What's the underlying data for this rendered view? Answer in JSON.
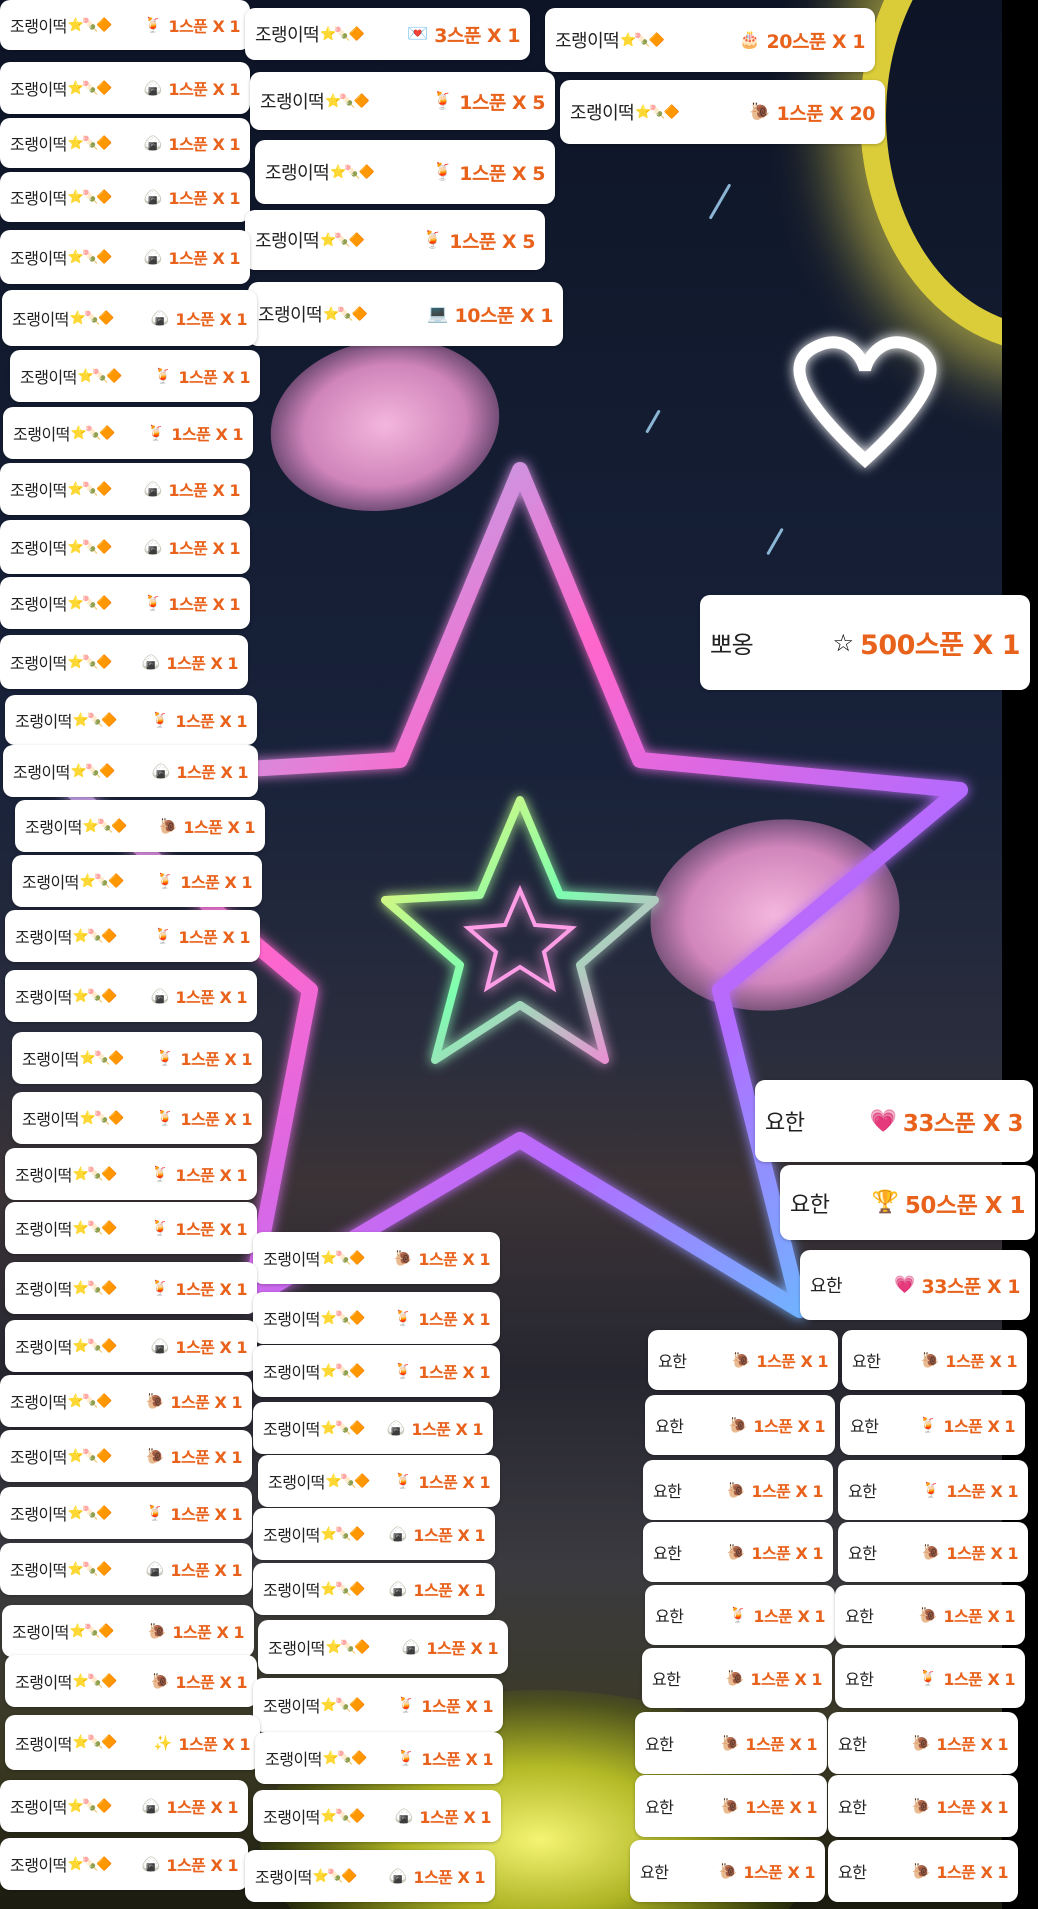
{
  "users": {
    "a": "조랭이떡",
    "b": "뽀옹",
    "c": "요한"
  },
  "badge_emoji": "⭐🍡🔶",
  "icons": {
    "juice": "🍹",
    "onigiri": "🍙",
    "snail": "🐌",
    "letter": "💌",
    "cake": "🎂",
    "laptop": "💻",
    "star": "☆",
    "gift_pink": "💗",
    "trophy": "🏆",
    "sparkle": "✨"
  },
  "amounts": {
    "s1x1": "1스푼 X 1",
    "s1x5": "1스푼 X 5",
    "s1x20": "1스푼 X 20",
    "s3x1": "3스푼 X 1",
    "s10x1": "10스푼 X 1",
    "s20x1": "20스푼 X 1",
    "s33x1": "33스푼 X 1",
    "s33x3": "33스푼 X 3",
    "s50x1": "50스푼 X 1",
    "s500x1": "500스푼 X 1"
  },
  "colors": {
    "amount": "#e8621c",
    "card_bg": "#ffffff",
    "name": "#222222"
  }
}
